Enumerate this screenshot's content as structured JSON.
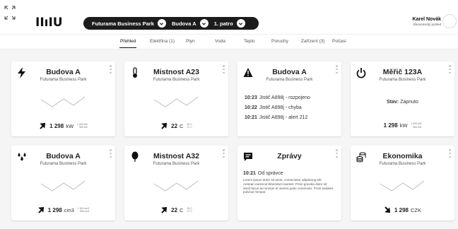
{
  "logo": {
    "text": "IIıIU"
  },
  "breadcrumb": [
    {
      "label": "Futurama Business Park"
    },
    {
      "label": "Budova A"
    },
    {
      "label": "1. patro"
    }
  ],
  "user": {
    "name": "Karel Novák",
    "role": "Ekonomický pohled"
  },
  "tabs": [
    {
      "label": "Přehled",
      "active": true
    },
    {
      "label": "Elektřina (1)"
    },
    {
      "label": "Plyn"
    },
    {
      "label": "Voda"
    },
    {
      "label": "Teplo"
    },
    {
      "label": "Poruchy"
    },
    {
      "label": "Zařízení (3)"
    },
    {
      "label": "Počasí"
    }
  ],
  "cards": {
    "elec": {
      "icon": "lightning-icon",
      "title": "Budova A",
      "subtitle": "Futurama Business Park",
      "value": "1 298",
      "unit": "kW",
      "range_top": "1 833 kW",
      "range_bottom": "984 kW",
      "trend": "up"
    },
    "temp1": {
      "icon": "thermometer-icon",
      "title": "Mistnost A23",
      "subtitle": "Futurama Business Park",
      "value": "22",
      "unit": "C",
      "range_top": "26 C",
      "range_bottom": "17 C",
      "trend": "up"
    },
    "alerts": {
      "icon": "warning-icon",
      "title": "Budova A",
      "subtitle": "Futurama Business Park",
      "events": [
        {
          "time": "10:23",
          "text": "Jistič A898j - rozpojeno"
        },
        {
          "time": "10:22",
          "text": "Jistič A898j - chyba"
        },
        {
          "time": "10:21",
          "text": "Jistič A898j - alert 212"
        }
      ]
    },
    "meter": {
      "icon": "power-icon",
      "title": "Měřič 123A",
      "subtitle": "Futurama Business Park",
      "state_label": "Stav:",
      "state_value": "Zapnuto",
      "value": "1 298",
      "unit": "kW",
      "range_top": "1 833 kW",
      "range_bottom": "984 kW"
    },
    "water": {
      "icon": "water-drops-icon",
      "title": "Budova A",
      "subtitle": "Futurama Business Park",
      "value": "1 298",
      "unit": "cm3",
      "range_top": "1 833 cm3",
      "range_bottom": "984 cm3",
      "trend": "up"
    },
    "temp2": {
      "icon": "balloon-icon",
      "title": "Mistnost A32",
      "subtitle": "Futurama Business Park",
      "value": "22",
      "unit": "C",
      "range_top": "26 C",
      "range_bottom": "17 C",
      "trend": "up"
    },
    "news": {
      "icon": "chat-icon",
      "title": "Zprávy",
      "time": "10:21",
      "author": "Od správce",
      "body": "Lorem ipsum dolor sit amet, consectetur adipiscing elit. Aenean euismod bibendum laoreet. Proin gravida dolor sit amet lacus accumsan et viverra justo commodo. Proin sodales pulvinar tempor."
    },
    "economy": {
      "icon": "coins-icon",
      "title": "Ekonomika",
      "subtitle": "Futurama Business Park",
      "value": "1 298",
      "unit": "CZK",
      "trend": "down"
    }
  },
  "colors": {
    "accent": "#1c1c1c",
    "background": "#f5f5f5",
    "card": "#ffffff",
    "sparkline": "#bdbdbd"
  }
}
